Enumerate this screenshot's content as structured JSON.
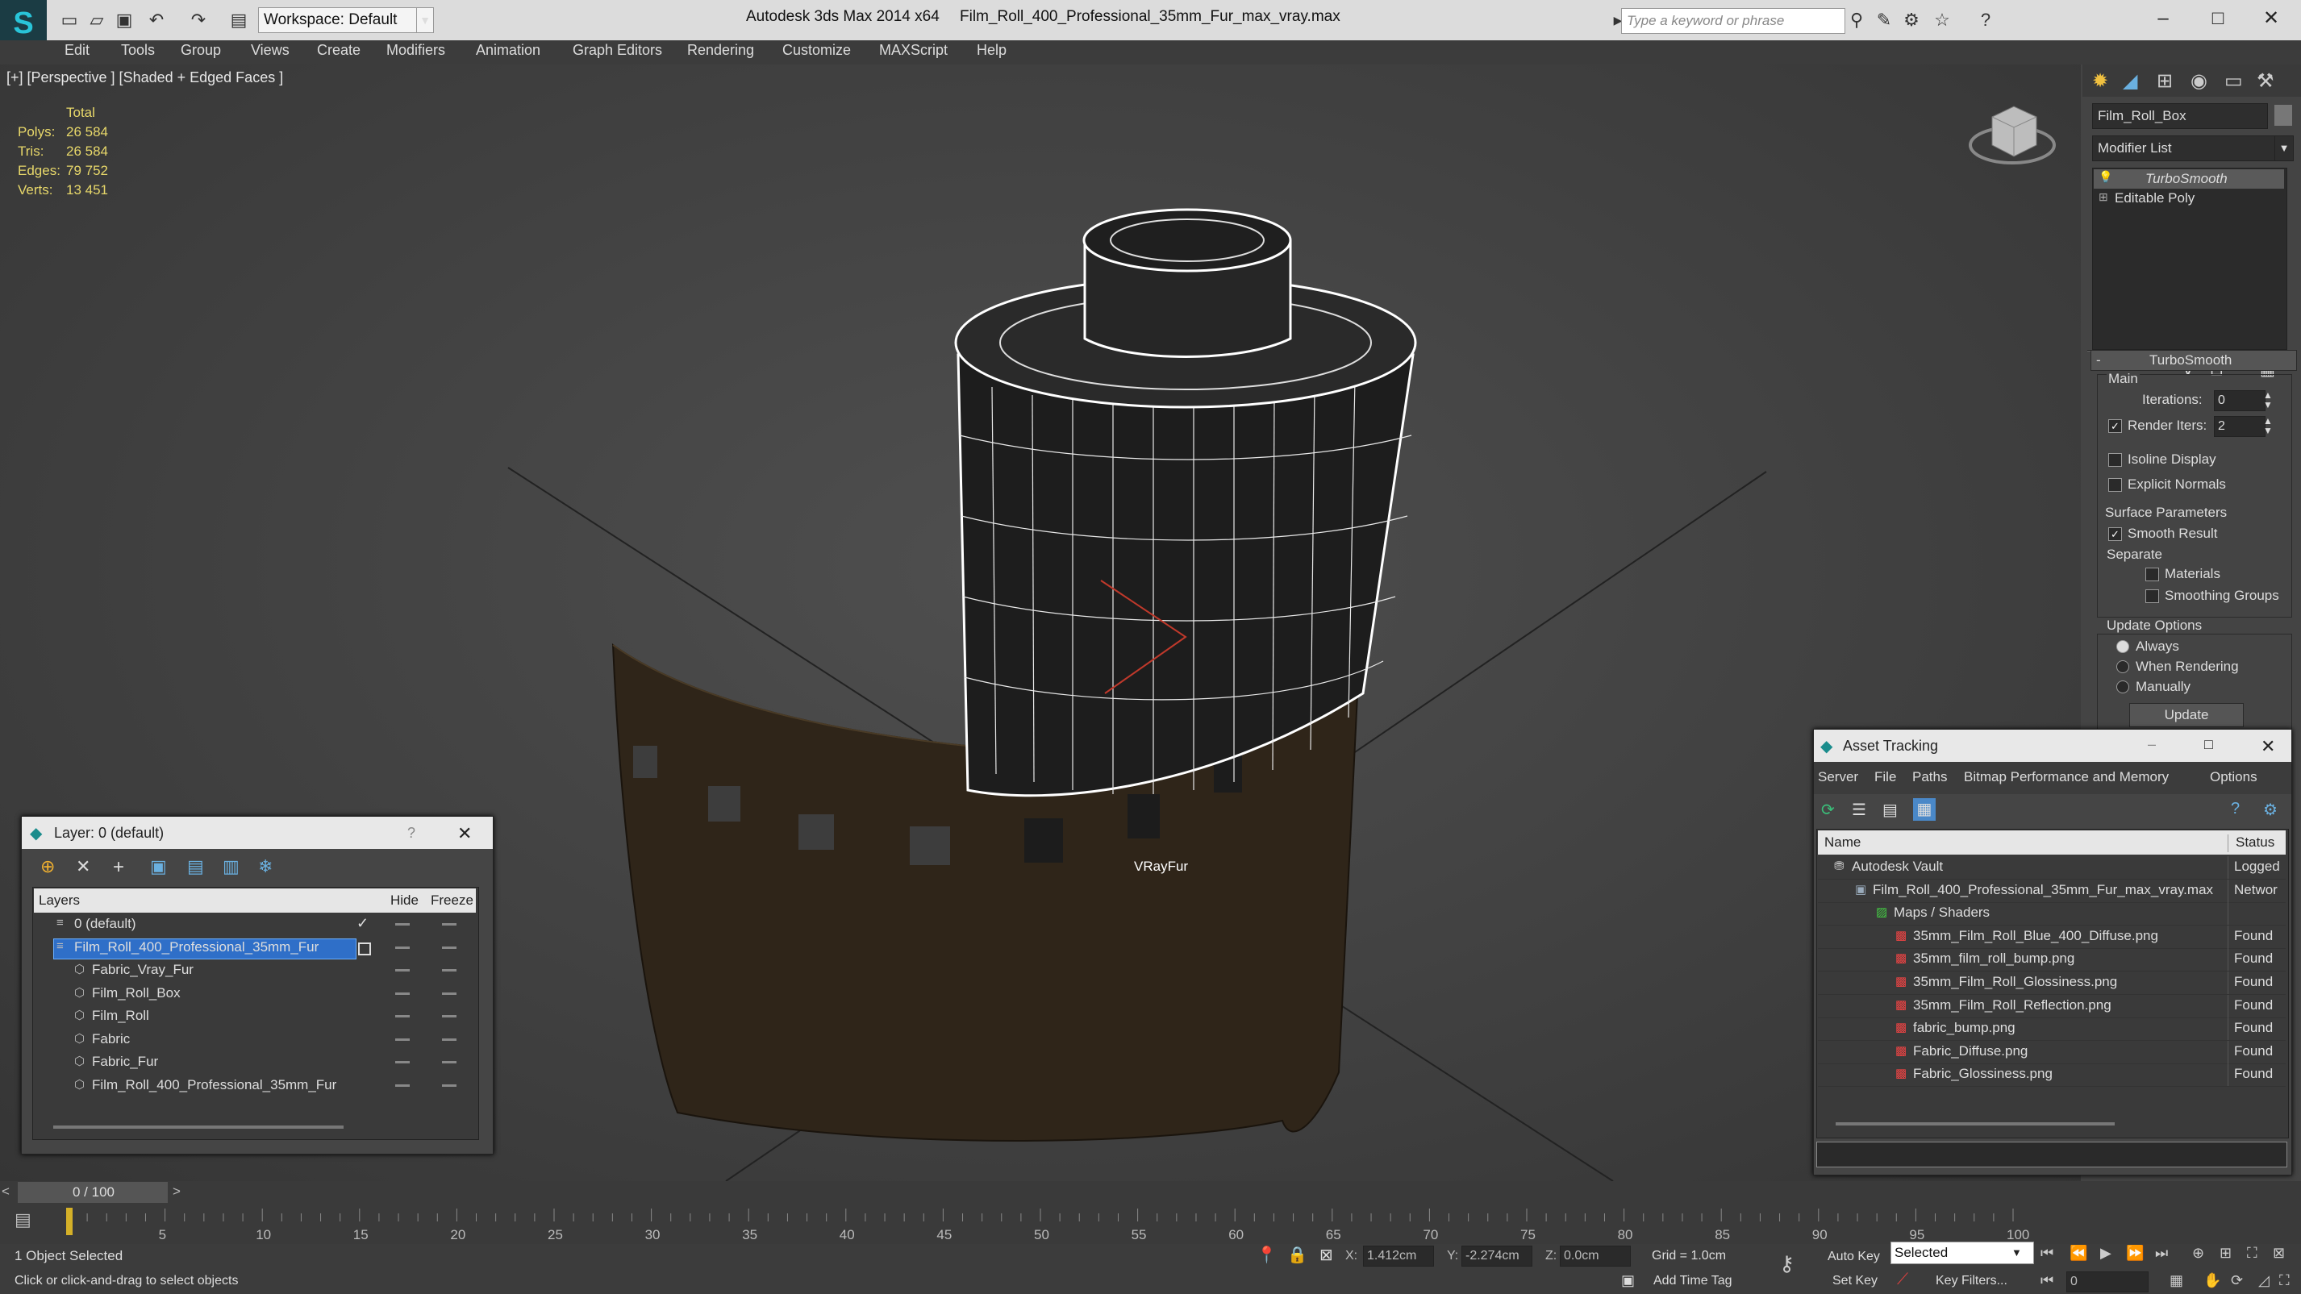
{
  "app": {
    "title_product": "Autodesk 3ds Max  2014 x64",
    "title_file": "Film_Roll_400_Professional_35mm_Fur_max_vray.max",
    "workspace": "Workspace: Default",
    "search_placeholder": "Type a keyword or phrase"
  },
  "menu": [
    "Edit",
    "Tools",
    "Group",
    "Views",
    "Create",
    "Modifiers",
    "Animation",
    "Graph Editors",
    "Rendering",
    "Customize",
    "MAXScript",
    "Help"
  ],
  "viewport": {
    "label": "[+] [Perspective ] [Shaded + Edged Faces ]",
    "stats_header": "Total",
    "stats": [
      {
        "label": "Polys:",
        "value": "26 584"
      },
      {
        "label": "Tris:",
        "value": "26 584"
      },
      {
        "label": "Edges:",
        "value": "79 752"
      },
      {
        "label": "Verts:",
        "value": "13 451"
      }
    ],
    "object_label": "VRayFur"
  },
  "command_panel": {
    "object_name": "Film_Roll_Box",
    "modifier_list": "Modifier List",
    "stack": [
      "TurboSmooth",
      "Editable Poly"
    ],
    "rollout_title": "TurboSmooth",
    "main_label": "Main",
    "iterations_label": "Iterations:",
    "iterations_value": "0",
    "render_iters_label": "Render Iters:",
    "render_iters_value": "2",
    "isoline": "Isoline Display",
    "explicit_normals": "Explicit Normals",
    "surface_params": "Surface Parameters",
    "smooth_result": "Smooth Result",
    "separate": "Separate",
    "materials": "Materials",
    "smoothing_groups": "Smoothing Groups",
    "update_options": "Update Options",
    "always": "Always",
    "when_rendering": "When Rendering",
    "manually": "Manually",
    "update_button": "Update"
  },
  "layer_window": {
    "title": "Layer: 0 (default)",
    "col_layers": "Layers",
    "col_hide": "Hide",
    "col_freeze": "Freeze",
    "rows": [
      {
        "name": "0 (default)",
        "indent": 0
      },
      {
        "name": "Film_Roll_400_Professional_35mm_Fur",
        "indent": 0,
        "selected": true
      },
      {
        "name": "Fabric_Vray_Fur",
        "indent": 1
      },
      {
        "name": "Film_Roll_Box",
        "indent": 1
      },
      {
        "name": "Film_Roll",
        "indent": 1
      },
      {
        "name": "Fabric",
        "indent": 1
      },
      {
        "name": "Fabric_Fur",
        "indent": 1
      },
      {
        "name": "Film_Roll_400_Professional_35mm_Fur",
        "indent": 1
      }
    ]
  },
  "asset_window": {
    "title": "Asset Tracking",
    "menu": [
      "Server",
      "File",
      "Paths",
      "Bitmap Performance and Memory",
      "Options"
    ],
    "col_name": "Name",
    "col_status": "Status",
    "rows": [
      {
        "name": "Autodesk Vault",
        "status": "Logged",
        "level": 0
      },
      {
        "name": "Film_Roll_400_Professional_35mm_Fur_max_vray.max",
        "status": "Networ",
        "level": 1
      },
      {
        "name": "Maps / Shaders",
        "status": "",
        "level": 2
      },
      {
        "name": "35mm_Film_Roll_Blue_400_Diffuse.png",
        "status": "Found",
        "level": 3
      },
      {
        "name": "35mm_film_roll_bump.png",
        "status": "Found",
        "level": 3
      },
      {
        "name": "35mm_Film_Roll_Glossiness.png",
        "status": "Found",
        "level": 3
      },
      {
        "name": "35mm_Film_Roll_Reflection.png",
        "status": "Found",
        "level": 3
      },
      {
        "name": "fabric_bump.png",
        "status": "Found",
        "level": 3
      },
      {
        "name": "Fabric_Diffuse.png",
        "status": "Found",
        "level": 3
      },
      {
        "name": "Fabric_Glossiness.png",
        "status": "Found",
        "level": 3
      }
    ]
  },
  "timeline": {
    "frame": "0 / 100",
    "ticks": [
      "5",
      "10",
      "15",
      "20",
      "25",
      "30",
      "35",
      "40",
      "45",
      "50",
      "55",
      "60",
      "65",
      "70",
      "75",
      "80",
      "85",
      "90",
      "95",
      "100"
    ]
  },
  "status": {
    "selected": "1 Object Selected",
    "prompt": "Click or click-and-drag to select objects",
    "x_label": "X:",
    "x_value": "1.412cm",
    "y_label": "Y:",
    "y_value": "-2.274cm",
    "z_label": "Z:",
    "z_value": "0.0cm",
    "grid": "Grid = 1.0cm",
    "add_time_tag": "Add Time Tag",
    "auto_key": "Auto Key",
    "set_key": "Set Key",
    "selected_dropdown": "Selected",
    "key_filters": "Key Filters...",
    "frame_value": "0"
  }
}
